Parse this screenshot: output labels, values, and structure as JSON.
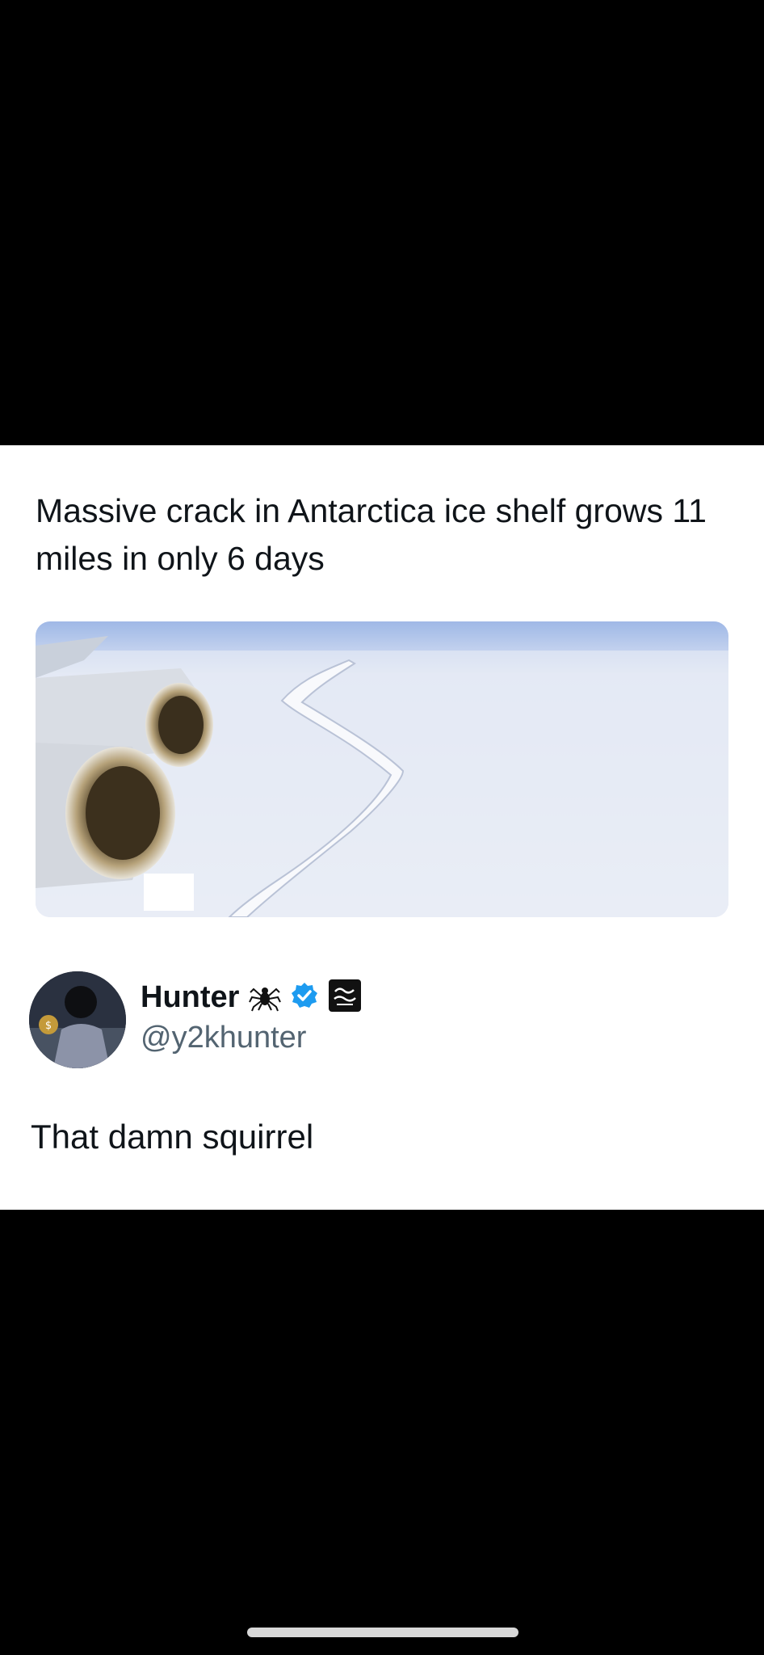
{
  "post": {
    "headline": "Massive crack in Antarctica ice shelf grows 11 miles in only 6 days",
    "image_subject": "aerial view of crack in ice shelf from airplane wing with jet engines"
  },
  "reply": {
    "display_name": "Hunter",
    "handle": "@y2khunter",
    "text": "That damn squirrel",
    "name_icons": [
      "spider-icon",
      "verified-badge-icon",
      "affiliate-badge-icon"
    ],
    "verified_color": "#1d9bf0"
  },
  "colors": {
    "background": "#000000",
    "card": "#ffffff",
    "text": "#0f1419",
    "secondary_text": "#536471"
  }
}
